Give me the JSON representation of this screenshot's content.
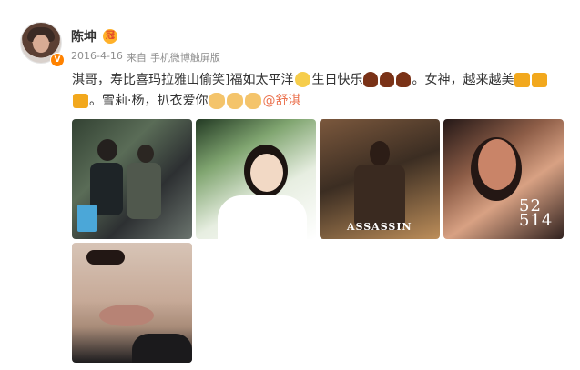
{
  "post": {
    "username": "陈坤",
    "date": "2016-4-16",
    "source_prefix": "来自",
    "source": "手机微博触屏版",
    "text_line1_start": "淇哥，寿比喜玛拉雅山偷笑]福如太平洋",
    "text_line1_mid": "生日快乐",
    "text_line1_end": "。女神，越来越美",
    "text_line2_start": "。雪莉·杨，扒衣爱你",
    "mention": "@舒淇"
  },
  "photos": {
    "third_title": "ASSASSIN",
    "fourth_overlay": "52 514"
  },
  "icons": {
    "verified": "vip-crown-icon",
    "emoji": [
      "pray-icon",
      "cake-icon",
      "beer-icon",
      "hug-icon"
    ]
  },
  "colors": {
    "text": "#333333",
    "meta": "#8e8e8e",
    "mention": "#eb7350",
    "verified": "#ff8200"
  }
}
